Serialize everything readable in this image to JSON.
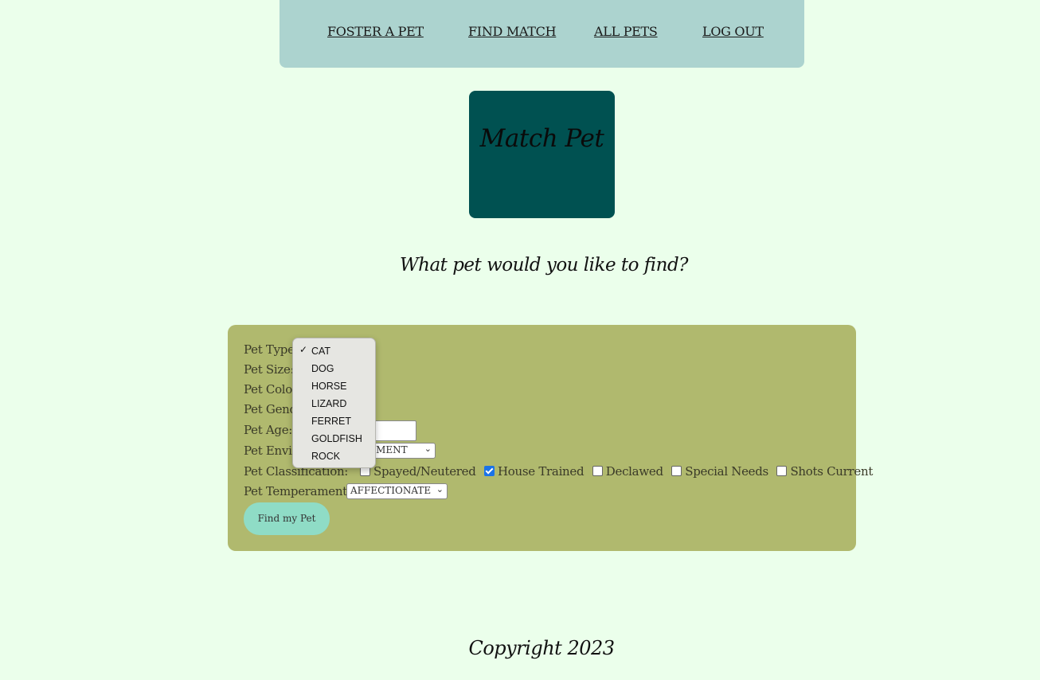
{
  "nav": {
    "items": [
      "FOSTER A PET",
      "FIND MATCH",
      "ALL PETS",
      "LOG OUT"
    ]
  },
  "hero": {
    "title": "Match Pet"
  },
  "question": "What pet would you like to find?",
  "form": {
    "type_label": "Pet Type:",
    "size_label": "Pet Size:",
    "color_label": "Pet Color:",
    "gender_label": "Pet Gender:",
    "age_label": "Pet Age:",
    "environment_label": "Pet Environment:",
    "environment_value": "APARTMENT",
    "classification_label": "Pet Classification:",
    "classifications": [
      {
        "label": "Spayed/Neutered",
        "checked": false
      },
      {
        "label": "House Trained",
        "checked": true
      },
      {
        "label": "Declawed",
        "checked": false
      },
      {
        "label": "Special Needs",
        "checked": false
      },
      {
        "label": "Shots Current",
        "checked": false
      }
    ],
    "temperament_label": "Pet Temperament:",
    "temperament_value": "AFFECTIONATE",
    "submit_label": "Find my Pet"
  },
  "type_dropdown": {
    "selected": "CAT",
    "options": [
      "CAT",
      "DOG",
      "HORSE",
      "LIZARD",
      "FERRET",
      "GOLDFISH",
      "ROCK"
    ]
  },
  "footer": "Copyright 2023",
  "colors": {
    "background": "#ebffeb",
    "nav": "#acd3cf",
    "hero": "#005151",
    "form": "#b0b96e",
    "button": "#8fdcc6"
  }
}
